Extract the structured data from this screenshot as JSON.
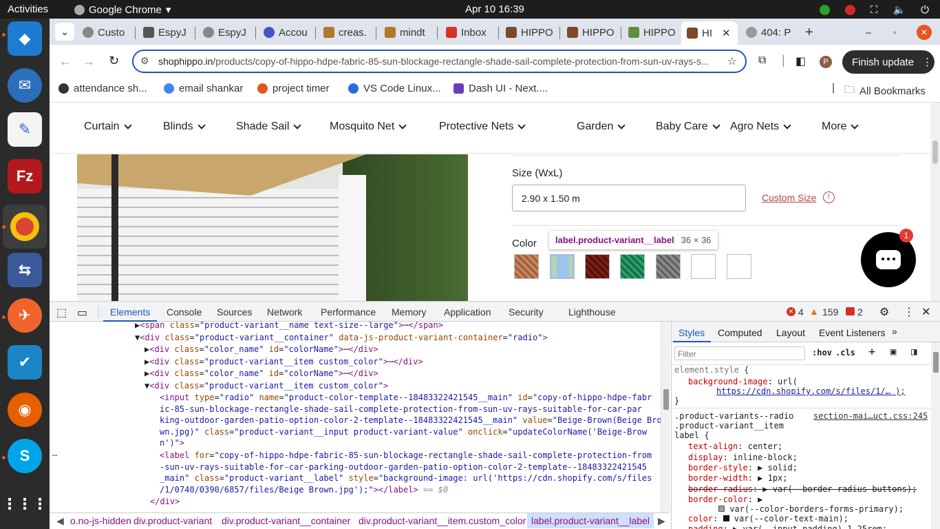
{
  "topbar": {
    "activities": "Activities",
    "app": "Google Chrome",
    "clock": "Apr 10  16:39"
  },
  "tabs": [
    "Custo",
    "EspyJ",
    "EspyJ",
    "Accou",
    "creas.",
    "mindt",
    "Inbox",
    "HIPPO",
    "HIPPO",
    "HIPPO",
    "HI",
    "404: P"
  ],
  "omnibox": {
    "host": "shophippo.in",
    "path": "/products/copy-of-hippo-hdpe-fabric-85-sun-blockage-rectangle-shade-sail-complete-protection-from-sun-uv-rays-s..."
  },
  "toolbar": {
    "finish_update": "Finish update",
    "profile": "P"
  },
  "bookmarks": [
    "attendance sh...",
    "email shankar",
    "project timer",
    "VS Code Linux...",
    "Dash UI - Next....",
    "All Bookmarks"
  ],
  "nav": [
    "Curtain",
    "Blinds",
    "Shade Sail",
    "Mosquito Net",
    "Protective Nets",
    "Garden",
    "Baby Care",
    "Agro Nets",
    "More"
  ],
  "product": {
    "size_label": "Size (WxL)",
    "size_value": "2.90 x 1.50 m",
    "custom_size": "Custom Size",
    "color_label": "Color",
    "chat_badge": "1"
  },
  "tooltip": {
    "selector": "label.product-variant__label",
    "dims": "36 × 36"
  },
  "devtools": {
    "tabs": [
      "Elements",
      "Console",
      "Sources",
      "Network",
      "Performance",
      "Memory",
      "Application",
      "Security",
      "Lighthouse"
    ],
    "errors": "4",
    "warnings": "159",
    "issues": "2",
    "style_tabs": [
      "Styles",
      "Computed",
      "Layout",
      "Event Listeners"
    ],
    "filter_placeholder": "Filter",
    "hov": ":hov",
    "cls": ".cls",
    "source": "section-mai…uct.css:245",
    "breadcrumbs": [
      "o.no-js-hidden",
      "div.product-variant",
      "div.product-variant__container",
      "div.product-variant__item.custom_color",
      "label.product-variant__label"
    ]
  },
  "colors": {
    "accent": "#1a57b8",
    "ubuntu": "#e95420",
    "selection": "#cfe0fb"
  }
}
